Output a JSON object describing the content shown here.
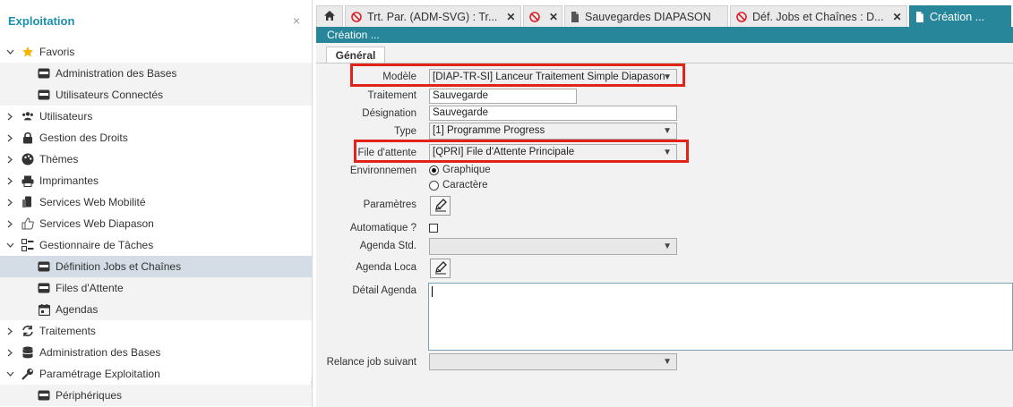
{
  "sidebar": {
    "title": "Exploitation",
    "close": "×",
    "items": [
      {
        "label": "Favoris",
        "icon": "star-icon",
        "expand": "v",
        "level": "top"
      },
      {
        "label": "Administration des Bases",
        "icon": "window-icon",
        "level": "child"
      },
      {
        "label": "Utilisateurs Connectés",
        "icon": "window-icon",
        "level": "child"
      },
      {
        "label": "Utilisateurs",
        "icon": "users-icon",
        "expand": ">",
        "level": "top"
      },
      {
        "label": "Gestion des Droits",
        "icon": "lock-icon",
        "expand": ">",
        "level": "top"
      },
      {
        "label": "Thèmes",
        "icon": "palette-icon",
        "expand": ">",
        "level": "top"
      },
      {
        "label": "Imprimantes",
        "icon": "printer-icon",
        "expand": ">",
        "level": "top"
      },
      {
        "label": "Services Web Mobilité",
        "icon": "mobile-icon",
        "expand": ">",
        "level": "top"
      },
      {
        "label": "Services Web Diapason",
        "icon": "thumb-icon",
        "expand": ">",
        "level": "top"
      },
      {
        "label": "Gestionnaire de Tâches",
        "icon": "tasks-icon",
        "expand": "v",
        "level": "top"
      },
      {
        "label": "Définition Jobs et Chaînes",
        "icon": "window-icon",
        "level": "child",
        "selected": true
      },
      {
        "label": "Files d'Attente",
        "icon": "window-icon",
        "level": "child"
      },
      {
        "label": "Agendas",
        "icon": "calendar-icon",
        "level": "child"
      },
      {
        "label": "Traitements",
        "icon": "refresh-icon",
        "expand": ">",
        "level": "top"
      },
      {
        "label": "Administration des Bases",
        "icon": "database-icon",
        "expand": ">",
        "level": "top"
      },
      {
        "label": "Paramétrage Exploitation",
        "icon": "wrench-icon",
        "expand": "v",
        "level": "top"
      },
      {
        "label": "Périphériques",
        "icon": "window-icon",
        "level": "child"
      }
    ]
  },
  "tabs": [
    {
      "label": "",
      "icon": "home-icon"
    },
    {
      "label": "Trt. Par. (ADM-SVG) : Tr...",
      "icon": "blocked-icon"
    },
    {
      "label": "",
      "icon": "blocked-icon"
    },
    {
      "label": "Sauvegardes DIAPASON",
      "icon": "document-icon"
    },
    {
      "label": "Déf. Jobs et Chaînes : D...",
      "icon": "blocked-icon"
    },
    {
      "label": "Création ...",
      "icon": "document-icon"
    }
  ],
  "subtitle": "Création ...",
  "form": {
    "tab_label": "Général",
    "modele_label": "Modèle",
    "modele_value": "[DIAP-TR-SI] Lanceur Traitement Simple Diapason",
    "traitement_label": "Traitement",
    "traitement_value": "Sauvegarde",
    "designation_label": "Désignation",
    "designation_value": "Sauvegarde",
    "type_label": "Type",
    "type_value": "[1] Programme Progress",
    "file_label": "File d'attente",
    "file_value": "[QPRI] File d'Attente Principale",
    "env_label": "Environnemen",
    "env_options": [
      "Graphique",
      "Caractère"
    ],
    "env_selected": "Graphique",
    "params_label": "Paramètres",
    "auto_label": "Automatique ?",
    "agenda_std_label": "Agenda Std.",
    "agenda_loca_label": "Agenda Loca",
    "detail_label": "Détail Agenda",
    "relance_label": "Relance job suivant"
  },
  "colors": {
    "accent": "#27869a",
    "title": "#1b8fb0",
    "highlight": "#e2231a",
    "selected_row": "#d4dde6"
  }
}
